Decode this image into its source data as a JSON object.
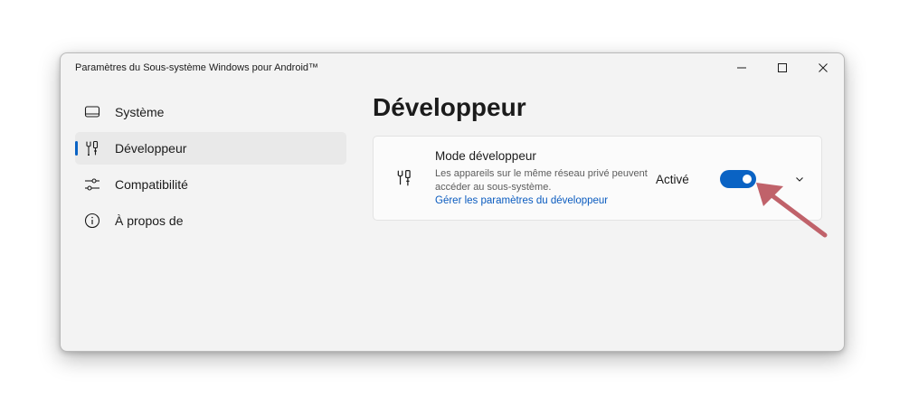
{
  "window": {
    "title": "Paramètres du Sous-système Windows pour Android™"
  },
  "titlebar": {
    "controls": [
      "minimize-icon",
      "maximize-icon",
      "close-icon"
    ]
  },
  "sidebar": {
    "items": [
      {
        "label": "Système",
        "icon": "laptop-icon",
        "selected": false
      },
      {
        "label": "Développeur",
        "icon": "developer-tools-icon",
        "selected": true
      },
      {
        "label": "Compatibilité",
        "icon": "sliders-icon",
        "selected": false
      },
      {
        "label": "À propos de",
        "icon": "info-icon",
        "selected": false
      }
    ]
  },
  "main": {
    "title": "Développeur",
    "card": {
      "icon": "developer-tools-icon",
      "title": "Mode développeur",
      "description": "Les appareils sur le même réseau privé peuvent accéder au sous-système.",
      "link": "Gérer les paramètres du développeur",
      "state_label": "Activé",
      "toggle_on": true,
      "expand_icon": "chevron-down-icon"
    }
  },
  "annotation": {
    "arrow_icon": "pointer-arrow-icon",
    "arrow_color": "#c0626a"
  },
  "colors": {
    "accent": "#0a63c4",
    "link": "#0a5bbf",
    "window_bg": "#f3f3f3",
    "card_bg": "#fbfbfb"
  }
}
